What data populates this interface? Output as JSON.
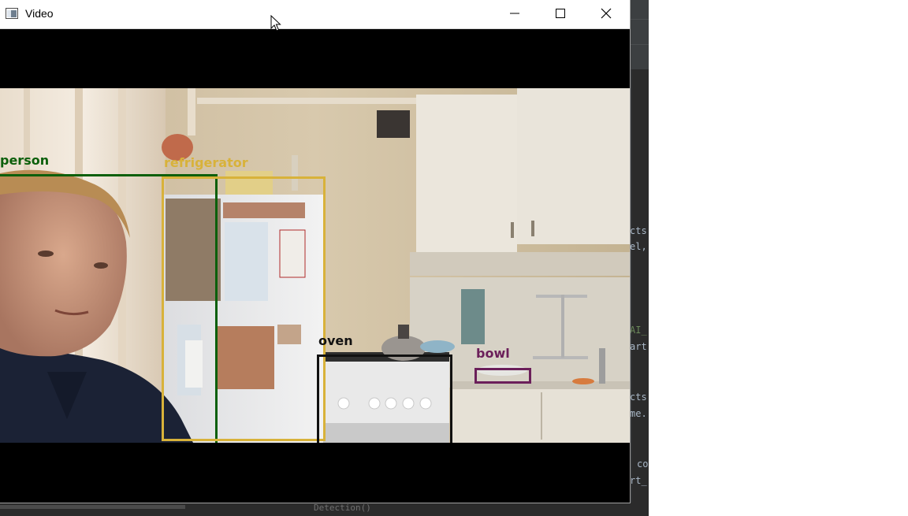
{
  "window": {
    "title": "Video",
    "controls": {
      "minimize": "minimize-icon",
      "maximize": "maximize-icon",
      "close": "close-icon"
    }
  },
  "video": {
    "detections": [
      {
        "label": "person",
        "color": "#0b5f0b"
      },
      {
        "label": "refrigerator",
        "color": "#d8b23a"
      },
      {
        "label": "oven",
        "color": "#111111"
      },
      {
        "label": "bowl",
        "color": "#6b1f5a"
      }
    ]
  },
  "ide": {
    "code_lines": [
      "cts",
      "el,",
      "AI_",
      "art",
      "cts",
      "me.",
      "co",
      "rt_"
    ],
    "status": "Detection()"
  },
  "colors": {
    "ide_bg": "#2b2b2b",
    "titlebar_bg": "#ffffff",
    "video_letterbox": "#000000"
  }
}
